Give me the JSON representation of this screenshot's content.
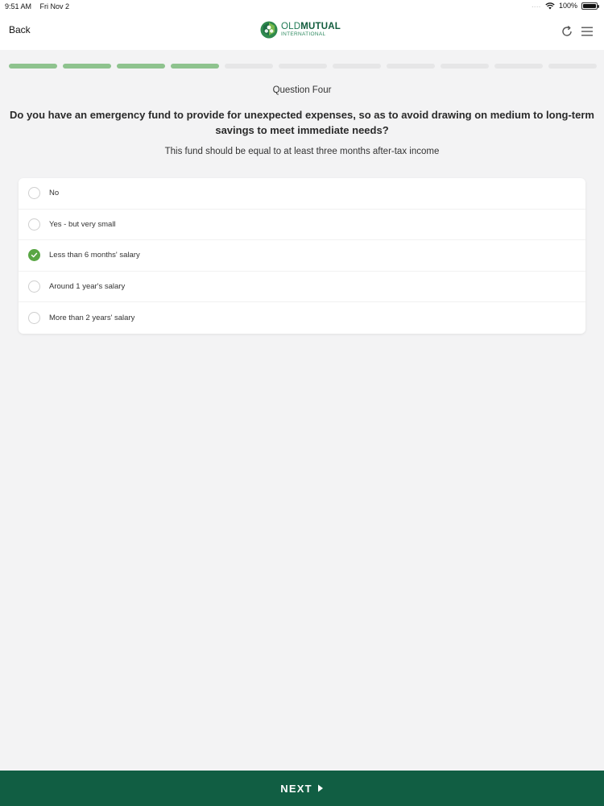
{
  "status": {
    "time": "9:51 AM",
    "date": "Fri Nov 2",
    "signal_dots": "....",
    "battery": "100%"
  },
  "nav": {
    "back_label": "Back",
    "logo_word1": "OLD",
    "logo_word2": "MUTUAL",
    "logo_sub": "INTERNATIONAL",
    "icons": [
      "refresh-icon",
      "hamburger-menu-icon"
    ]
  },
  "progress": {
    "total": 11,
    "completed": 4
  },
  "question": {
    "number_label": "Question Four",
    "text": "Do you have an emergency fund to provide for unexpected expenses, so as to avoid drawing on medium to long-term savings to meet immediate needs?",
    "hint": "This fund should be equal to at least three months after-tax income"
  },
  "options": [
    {
      "label": "No",
      "selected": false
    },
    {
      "label": "Yes - but very small",
      "selected": false
    },
    {
      "label": "Less than 6 months' salary",
      "selected": true
    },
    {
      "label": "Around 1 year's salary",
      "selected": false
    },
    {
      "label": "More than 2 years' salary",
      "selected": false
    }
  ],
  "footer": {
    "next_label": "NEXT"
  },
  "colors": {
    "brand_green": "#115e43",
    "progress_done": "#8ec38e",
    "progress_todo": "#e6e6e7",
    "radio_selected": "#59a644"
  }
}
